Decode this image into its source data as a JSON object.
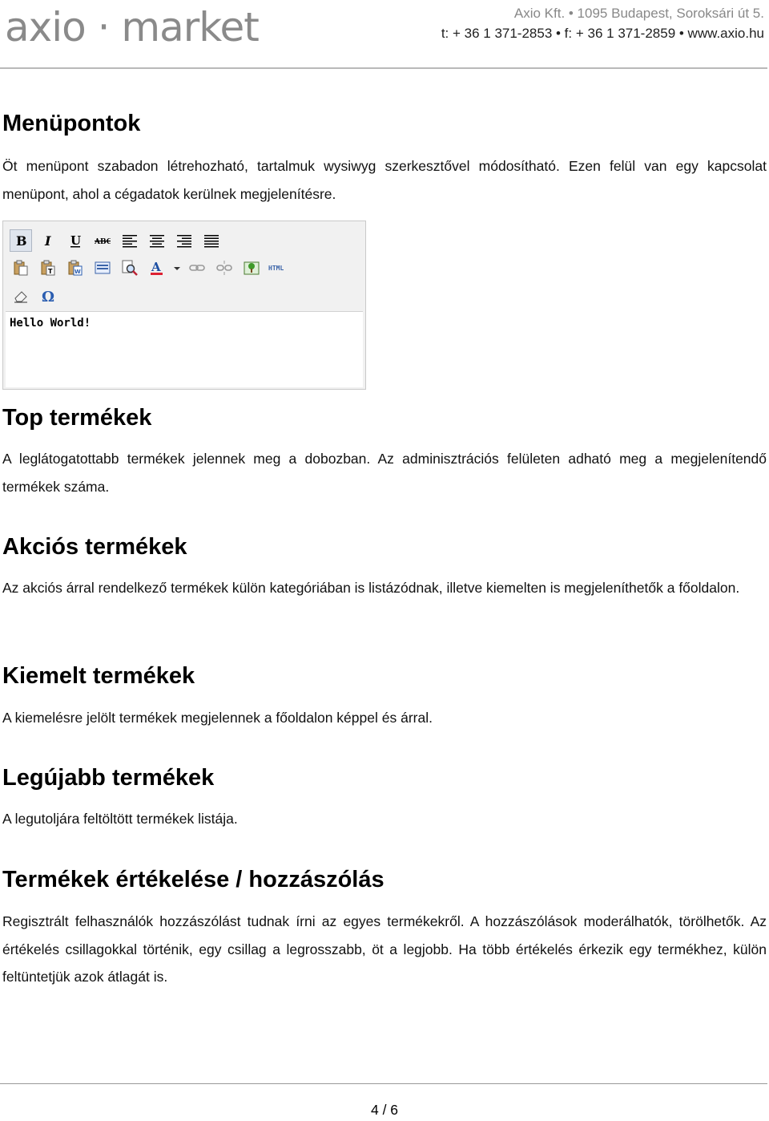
{
  "header": {
    "logo_text": "axio · market",
    "address": "Axio Kft. • 1095 Budapest, Soroksári út 5.",
    "contact": "t: + 36 1 371-2853 • f: + 36 1 371-2859 • www.axio.hu"
  },
  "sections": [
    {
      "title": "Menüpontok",
      "text": "Öt menüpont szabadon létrehozható, tartalmuk wysiwyg szerkesztővel módosítható. Ezen felül van egy kapcsolat menüpont, ahol a cégadatok kerülnek megjelenítésre."
    },
    {
      "title": "Top termékek",
      "text": "A leglátogatottabb termékek jelennek meg a dobozban. Az adminisztrációs felületen adható meg a megjelenítendő termékek száma."
    },
    {
      "title": "Akciós termékek",
      "text": "Az akciós árral rendelkező termékek külön kategóriában is listázódnak, illetve kiemelten is megjeleníthetők a főoldalon."
    },
    {
      "title": "Kiemelt termékek",
      "text": "A kiemelésre jelölt termékek megjelennek a főoldalon képpel és árral."
    },
    {
      "title": "Legújabb termékek",
      "text": "A legutoljára feltöltött termékek listája."
    },
    {
      "title": "Termékek értékelése / hozzászólás",
      "text": "Regisztrált felhasználók hozzászólást tudnak írni az egyes termékekről. A hozzászólások moderálhatók, törölhetők. Az értékelés csillagokkal történik, egy csillag a legrosszabb, öt a legjobb. Ha több értékelés érkezik egy termékhez, külön feltüntetjük azok átlagát is."
    }
  ],
  "editor": {
    "content": "Hello World!",
    "html_label": "HTML",
    "icons_row1": [
      "bold-icon",
      "italic-icon",
      "underline-icon",
      "strikethrough-icon",
      "align-left-icon",
      "align-center-icon",
      "align-right-icon",
      "align-justify-icon"
    ],
    "icons_row2": [
      "paste-icon",
      "paste-text-icon",
      "paste-word-icon",
      "select-all-icon",
      "find-icon",
      "text-color-icon",
      "link-icon",
      "unlink-icon",
      "image-icon",
      "html-source-icon"
    ],
    "icons_row3": [
      "eraser-icon",
      "special-char-icon"
    ]
  },
  "footer": {
    "page": "4 / 6"
  },
  "colors": {
    "logo_gray": "#8a8a8a",
    "header_rule": "#b9b9b9"
  }
}
